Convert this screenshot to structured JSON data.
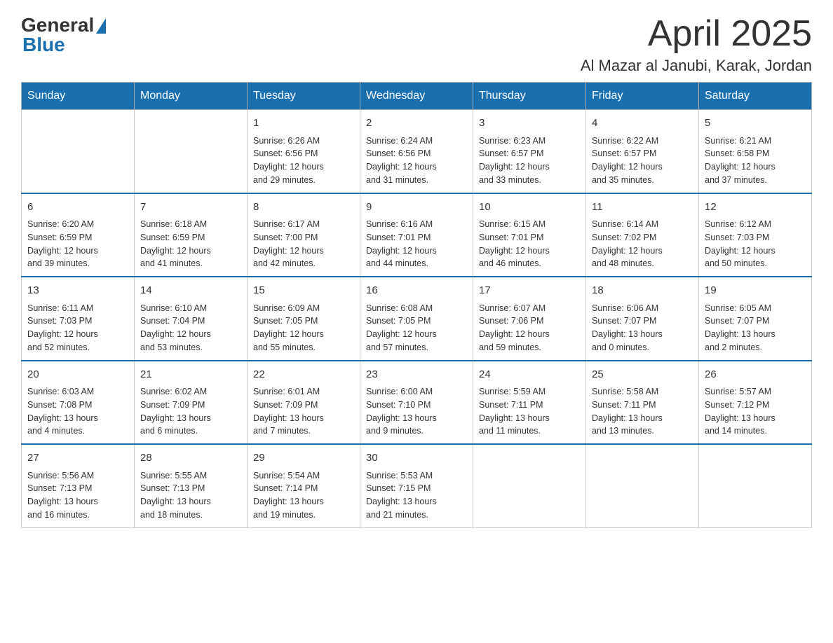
{
  "header": {
    "logo_general": "General",
    "logo_blue": "Blue",
    "month_title": "April 2025",
    "location": "Al Mazar al Janubi, Karak, Jordan"
  },
  "weekdays": [
    "Sunday",
    "Monday",
    "Tuesday",
    "Wednesday",
    "Thursday",
    "Friday",
    "Saturday"
  ],
  "weeks": [
    [
      {
        "day": "",
        "info": ""
      },
      {
        "day": "",
        "info": ""
      },
      {
        "day": "1",
        "info": "Sunrise: 6:26 AM\nSunset: 6:56 PM\nDaylight: 12 hours\nand 29 minutes."
      },
      {
        "day": "2",
        "info": "Sunrise: 6:24 AM\nSunset: 6:56 PM\nDaylight: 12 hours\nand 31 minutes."
      },
      {
        "day": "3",
        "info": "Sunrise: 6:23 AM\nSunset: 6:57 PM\nDaylight: 12 hours\nand 33 minutes."
      },
      {
        "day": "4",
        "info": "Sunrise: 6:22 AM\nSunset: 6:57 PM\nDaylight: 12 hours\nand 35 minutes."
      },
      {
        "day": "5",
        "info": "Sunrise: 6:21 AM\nSunset: 6:58 PM\nDaylight: 12 hours\nand 37 minutes."
      }
    ],
    [
      {
        "day": "6",
        "info": "Sunrise: 6:20 AM\nSunset: 6:59 PM\nDaylight: 12 hours\nand 39 minutes."
      },
      {
        "day": "7",
        "info": "Sunrise: 6:18 AM\nSunset: 6:59 PM\nDaylight: 12 hours\nand 41 minutes."
      },
      {
        "day": "8",
        "info": "Sunrise: 6:17 AM\nSunset: 7:00 PM\nDaylight: 12 hours\nand 42 minutes."
      },
      {
        "day": "9",
        "info": "Sunrise: 6:16 AM\nSunset: 7:01 PM\nDaylight: 12 hours\nand 44 minutes."
      },
      {
        "day": "10",
        "info": "Sunrise: 6:15 AM\nSunset: 7:01 PM\nDaylight: 12 hours\nand 46 minutes."
      },
      {
        "day": "11",
        "info": "Sunrise: 6:14 AM\nSunset: 7:02 PM\nDaylight: 12 hours\nand 48 minutes."
      },
      {
        "day": "12",
        "info": "Sunrise: 6:12 AM\nSunset: 7:03 PM\nDaylight: 12 hours\nand 50 minutes."
      }
    ],
    [
      {
        "day": "13",
        "info": "Sunrise: 6:11 AM\nSunset: 7:03 PM\nDaylight: 12 hours\nand 52 minutes."
      },
      {
        "day": "14",
        "info": "Sunrise: 6:10 AM\nSunset: 7:04 PM\nDaylight: 12 hours\nand 53 minutes."
      },
      {
        "day": "15",
        "info": "Sunrise: 6:09 AM\nSunset: 7:05 PM\nDaylight: 12 hours\nand 55 minutes."
      },
      {
        "day": "16",
        "info": "Sunrise: 6:08 AM\nSunset: 7:05 PM\nDaylight: 12 hours\nand 57 minutes."
      },
      {
        "day": "17",
        "info": "Sunrise: 6:07 AM\nSunset: 7:06 PM\nDaylight: 12 hours\nand 59 minutes."
      },
      {
        "day": "18",
        "info": "Sunrise: 6:06 AM\nSunset: 7:07 PM\nDaylight: 13 hours\nand 0 minutes."
      },
      {
        "day": "19",
        "info": "Sunrise: 6:05 AM\nSunset: 7:07 PM\nDaylight: 13 hours\nand 2 minutes."
      }
    ],
    [
      {
        "day": "20",
        "info": "Sunrise: 6:03 AM\nSunset: 7:08 PM\nDaylight: 13 hours\nand 4 minutes."
      },
      {
        "day": "21",
        "info": "Sunrise: 6:02 AM\nSunset: 7:09 PM\nDaylight: 13 hours\nand 6 minutes."
      },
      {
        "day": "22",
        "info": "Sunrise: 6:01 AM\nSunset: 7:09 PM\nDaylight: 13 hours\nand 7 minutes."
      },
      {
        "day": "23",
        "info": "Sunrise: 6:00 AM\nSunset: 7:10 PM\nDaylight: 13 hours\nand 9 minutes."
      },
      {
        "day": "24",
        "info": "Sunrise: 5:59 AM\nSunset: 7:11 PM\nDaylight: 13 hours\nand 11 minutes."
      },
      {
        "day": "25",
        "info": "Sunrise: 5:58 AM\nSunset: 7:11 PM\nDaylight: 13 hours\nand 13 minutes."
      },
      {
        "day": "26",
        "info": "Sunrise: 5:57 AM\nSunset: 7:12 PM\nDaylight: 13 hours\nand 14 minutes."
      }
    ],
    [
      {
        "day": "27",
        "info": "Sunrise: 5:56 AM\nSunset: 7:13 PM\nDaylight: 13 hours\nand 16 minutes."
      },
      {
        "day": "28",
        "info": "Sunrise: 5:55 AM\nSunset: 7:13 PM\nDaylight: 13 hours\nand 18 minutes."
      },
      {
        "day": "29",
        "info": "Sunrise: 5:54 AM\nSunset: 7:14 PM\nDaylight: 13 hours\nand 19 minutes."
      },
      {
        "day": "30",
        "info": "Sunrise: 5:53 AM\nSunset: 7:15 PM\nDaylight: 13 hours\nand 21 minutes."
      },
      {
        "day": "",
        "info": ""
      },
      {
        "day": "",
        "info": ""
      },
      {
        "day": "",
        "info": ""
      }
    ]
  ]
}
